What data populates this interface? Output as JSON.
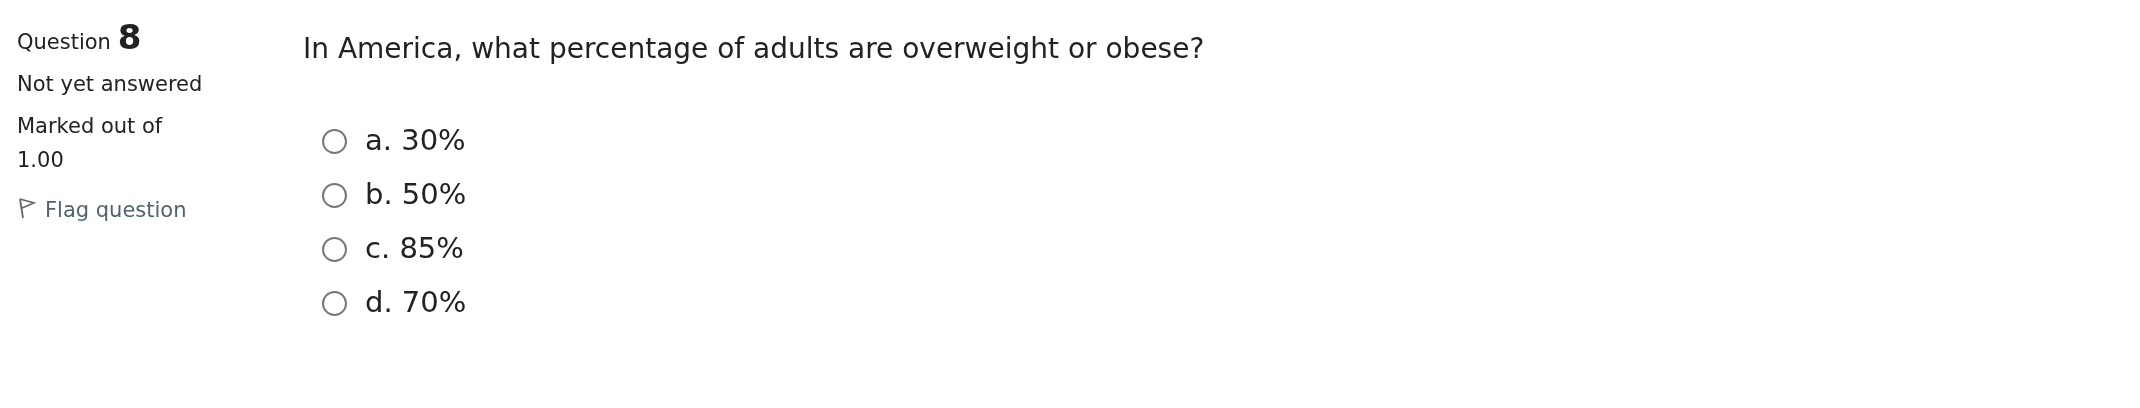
{
  "info": {
    "question_label": "Question",
    "question_number": "8",
    "status": "Not yet answered",
    "mark": "Marked out of 1.00",
    "flag": {
      "label": "Flag question",
      "flagged": false
    }
  },
  "question": {
    "text": "In America, what percentage of adults are overweight or obese?",
    "options": [
      {
        "label": "a. 30%",
        "selected": false
      },
      {
        "label": "b. 50%",
        "selected": false
      },
      {
        "label": "c. 85%",
        "selected": false
      },
      {
        "label": "d. 70%",
        "selected": false
      }
    ]
  }
}
